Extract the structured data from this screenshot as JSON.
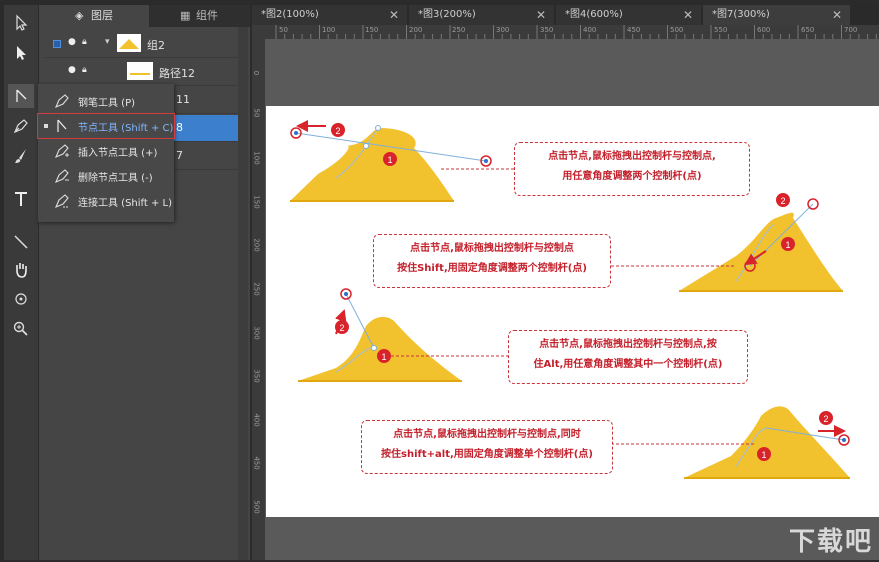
{
  "toolbar": {
    "tools": [
      "select-icon",
      "direct-select-icon",
      "node-tool-icon",
      "pen-icon",
      "brush-icon",
      "text-icon",
      "line-icon",
      "hand-icon",
      "rotate-view-icon",
      "zoom-icon"
    ]
  },
  "panel": {
    "tabs": {
      "layers": "图层",
      "components": "组件"
    },
    "layers": [
      {
        "name": "组2"
      },
      {
        "name": "路径12"
      },
      {
        "name": "11"
      },
      {
        "name": "8"
      },
      {
        "name": "7"
      }
    ]
  },
  "flyout": {
    "items": [
      {
        "label": "钢笔工具 (P)"
      },
      {
        "label": "节点工具 (Shift + C)"
      },
      {
        "label": "插入节点工具 (+)"
      },
      {
        "label": "删除节点工具 (-)"
      },
      {
        "label": "连接工具 (Shift + L)"
      }
    ]
  },
  "doc_tabs": [
    {
      "label": "*图2(100%)"
    },
    {
      "label": "*图3(200%)"
    },
    {
      "label": "*图4(600%)"
    },
    {
      "label": "*图7(300%)"
    }
  ],
  "ruler": {
    "top": [
      "50",
      "100",
      "150",
      "200",
      "250",
      "300",
      "350",
      "400",
      "450",
      "500",
      "550",
      "600",
      "650",
      "700"
    ],
    "left": [
      "0",
      "50",
      "100",
      "150",
      "200",
      "250",
      "300",
      "350",
      "400",
      "450",
      "500"
    ]
  },
  "callouts": [
    {
      "line1": "点击节点,鼠标拖拽出控制杆与控制点,",
      "line2": "用任意角度调整两个控制杆(点)"
    },
    {
      "line1": "点击节点,鼠标拖拽出控制杆与控制点",
      "line2": "按住Shift,用固定角度调整两个控制杆(点)"
    },
    {
      "line1": "点击节点,鼠标拖拽出控制杆与控制点,按",
      "line2": "住Alt,用任意角度调整其中一个控制杆(点)"
    },
    {
      "line1": "点击节点,鼠标拖拽出控制杆与控制点,同时",
      "line2": "按住shift+alt,用固定角度调整单个控制杆(点)"
    }
  ],
  "markers": {
    "one": "1",
    "two": "2"
  },
  "colors": {
    "accent_red": "#c41f2a",
    "shape_yellow": "#f2c12e",
    "selection_blue": "#3c8fd6"
  },
  "watermark": "下载吧"
}
